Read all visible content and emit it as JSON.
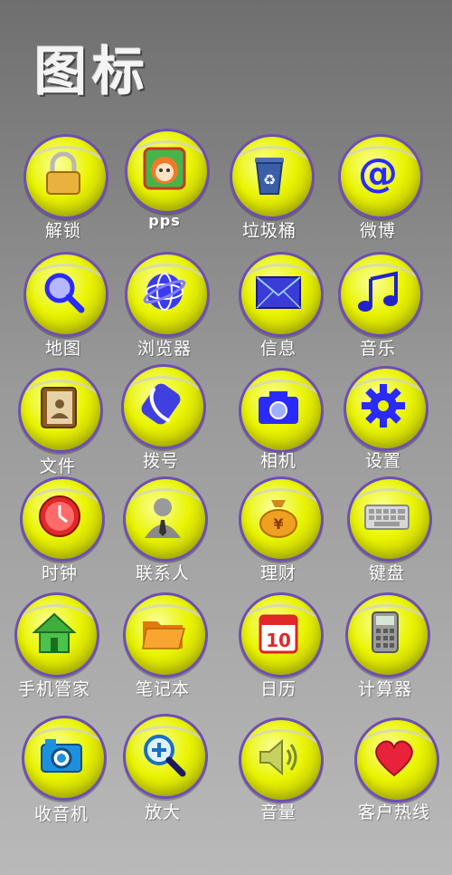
{
  "title": "图标",
  "icons": [
    {
      "label": "解锁",
      "icon": "padlock-icon"
    },
    {
      "label": "pps",
      "icon": "pps-app-icon"
    },
    {
      "label": "垃圾桶",
      "icon": "recycle-bin-icon"
    },
    {
      "label": "微博",
      "icon": "at-sign-icon"
    },
    {
      "label": "地图",
      "icon": "map-magnifier-icon"
    },
    {
      "label": "浏览器",
      "icon": "globe-browser-icon"
    },
    {
      "label": "信息",
      "icon": "envelope-icon"
    },
    {
      "label": "音乐",
      "icon": "music-note-icon"
    },
    {
      "label": "文件",
      "icon": "contacts-book-icon"
    },
    {
      "label": "拨号",
      "icon": "phone-handset-icon"
    },
    {
      "label": "相机",
      "icon": "camera-icon"
    },
    {
      "label": "设置",
      "icon": "gear-icon"
    },
    {
      "label": "时钟",
      "icon": "clock-icon"
    },
    {
      "label": "联系人",
      "icon": "person-icon"
    },
    {
      "label": "理财",
      "icon": "money-bag-icon"
    },
    {
      "label": "键盘",
      "icon": "keyboard-icon"
    },
    {
      "label": "手机管家",
      "icon": "house-icon"
    },
    {
      "label": "笔记本",
      "icon": "folder-icon"
    },
    {
      "label": "日历",
      "icon": "calendar-icon"
    },
    {
      "label": "计算器",
      "icon": "calculator-icon"
    },
    {
      "label": "收音机",
      "icon": "radio-camera-icon"
    },
    {
      "label": "放大",
      "icon": "zoom-in-icon"
    },
    {
      "label": "音量",
      "icon": "speaker-icon"
    },
    {
      "label": "客户热线",
      "icon": "heart-icon"
    }
  ],
  "calendar_day": "10",
  "colors": {
    "ring": "#6c4fb3",
    "ball": "#e9f400",
    "accent_blue": "#2a2aff"
  }
}
